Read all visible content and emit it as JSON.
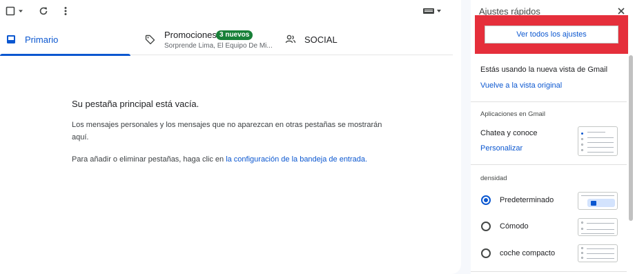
{
  "colors": {
    "accent": "#0b57d0",
    "badge": "#188038",
    "highlight": "#e52f3b"
  },
  "toolbar": {
    "select_icon": "checkbox-icon",
    "dropdown_icon": "caret-down-icon",
    "refresh_icon": "refresh-icon",
    "more_icon": "more-vert-icon",
    "keyboard_icon": "keyboard-icon"
  },
  "tabs": [
    {
      "label": "Primario",
      "icon": "inbox-icon",
      "selected": true
    },
    {
      "label": "Promociones",
      "icon": "tag-icon",
      "badge": "3 nuevos",
      "subtitle": "Sorprende Lima, El Equipo De Mi..."
    },
    {
      "label": "SOCIAL",
      "icon": "people-icon"
    }
  ],
  "empty": {
    "heading": "Su pestaña principal está vacía.",
    "desc": "Los mensajes personales y los mensajes que no aparezcan en otras pestañas se mostrarán aquí.",
    "instr_prefix": "Para añadir o eliminar pestañas, haga clic en ",
    "instr_link": "la configuración de la bandeja de entrada."
  },
  "panel": {
    "title": "Ajustes rápidos",
    "close_icon": "close-icon",
    "see_all": "Ver todos los ajustes",
    "new_view_text": "Estás usando la nueva vista de Gmail",
    "back_link": "Vuelve a la vista original",
    "apps_heading": "Aplicaciones en Gmail",
    "apps_text": "Chatea y conoce",
    "customize_link": "Personalizar",
    "density_heading": "densidad",
    "density_options": [
      {
        "label": "Predeterminado",
        "selected": true
      },
      {
        "label": "Cómodo",
        "selected": false
      },
      {
        "label": "coche compacto",
        "selected": false
      }
    ]
  }
}
